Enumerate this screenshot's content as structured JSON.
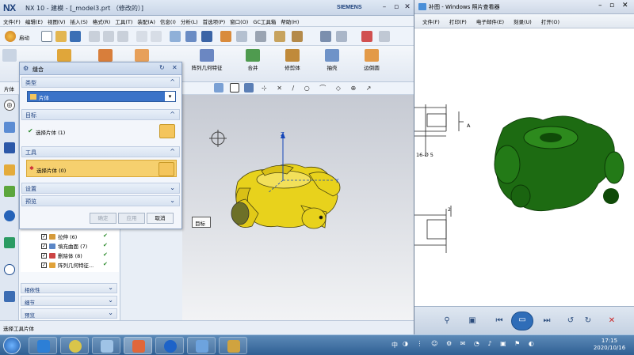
{
  "nx": {
    "logo": "NX",
    "title": "NX 10 - 建模 - [_model3.prt （修改的）]",
    "brand": "SIEMENS",
    "menus": [
      "文件(F)",
      "编辑(E)",
      "视图(V)",
      "插入(S)",
      "格式(R)",
      "工具(T)",
      "装配(A)",
      "信息(I)",
      "分析(L)",
      "首选项(P)",
      "窗口(O)",
      "GC工具箱",
      "帮助(H)"
    ],
    "start_label": "启动",
    "ribbon": [
      "拉伸",
      "孔",
      "阵列几何特征",
      "合并",
      "修剪体",
      "抽壳",
      "边倒圆"
    ],
    "filter": "片体",
    "status": "选择工具片体"
  },
  "dialog": {
    "title": "缝合",
    "type_header": "类型",
    "type_value": "片体",
    "target_header": "目标",
    "target_row": "选择片体 (1)",
    "tool_header": "工具",
    "tool_row": "选择片体 (0)",
    "settings_header": "设置",
    "preview_header": "预览",
    "btn_ok": "确定",
    "btn_apply": "应用",
    "btn_cancel": "取消"
  },
  "navigator": {
    "items": [
      "拉伸 (6)",
      "填充曲面 (7)",
      "删除体 (8)",
      "阵列几何特征..."
    ],
    "sections": [
      "相依性",
      "细节",
      "预览"
    ]
  },
  "viewport": {
    "tooltip": "目标",
    "axis_z": "Z",
    "axis_y": "Y",
    "axis_x": "X"
  },
  "photo_viewer": {
    "title": "补图 - Windows 照片查看器",
    "menus": [
      "文件(F)",
      "打印(P)",
      "电子邮件(E)",
      "刻录(U)",
      "打开(O)"
    ],
    "drawing_label_a": "A",
    "drawing_label_b": "16-Ø 5",
    "drawing_label_c": "2"
  },
  "taskbar": {
    "time": "17:15",
    "date": "2020/10/16",
    "ime": "中"
  },
  "colors": {
    "part_yellow": "#e8d21c",
    "part_green": "#1d6b12",
    "dialog_accent": "#f4c55c"
  }
}
